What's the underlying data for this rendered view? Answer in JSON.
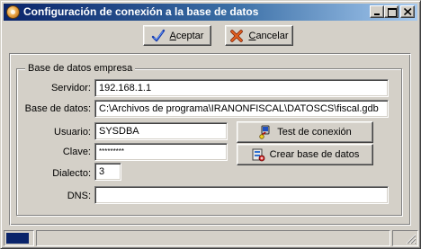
{
  "window": {
    "title": "Configuración de conexión a la base de datos"
  },
  "toolbar": {
    "accept": {
      "prefix": "",
      "mnemonic": "A",
      "suffix": "ceptar",
      "icon": "checkmark-icon"
    },
    "cancel": {
      "prefix": "",
      "mnemonic": "C",
      "suffix": "ancelar",
      "icon": "red-x-icon"
    }
  },
  "group": {
    "legend": "Base de datos empresa"
  },
  "form": {
    "servidor": {
      "label": "Servidor:",
      "value": "192.168.1.1"
    },
    "base": {
      "label": "Base de datos:",
      "value": "C:\\Archivos de programa\\IRANONFISCAL\\DATOSCS\\fiscal.gdb"
    },
    "usuario": {
      "label": "Usuario:",
      "value": "SYSDBA"
    },
    "clave": {
      "label": "Clave:",
      "value": "*********"
    },
    "dialecto": {
      "label": "Dialecto:",
      "value": "3"
    },
    "dns": {
      "label": "DNS:",
      "value": ""
    }
  },
  "actions": {
    "test": {
      "label": "Test de conexión",
      "icon": "connection-icon"
    },
    "crear": {
      "label": "Crear base de datos",
      "icon": "database-icon"
    }
  },
  "statusbar": {
    "progress_fraction": 0.9
  },
  "colors": {
    "titlebar_start": "#0a246a",
    "titlebar_end": "#a6caf0",
    "face": "#d4d0c8"
  }
}
